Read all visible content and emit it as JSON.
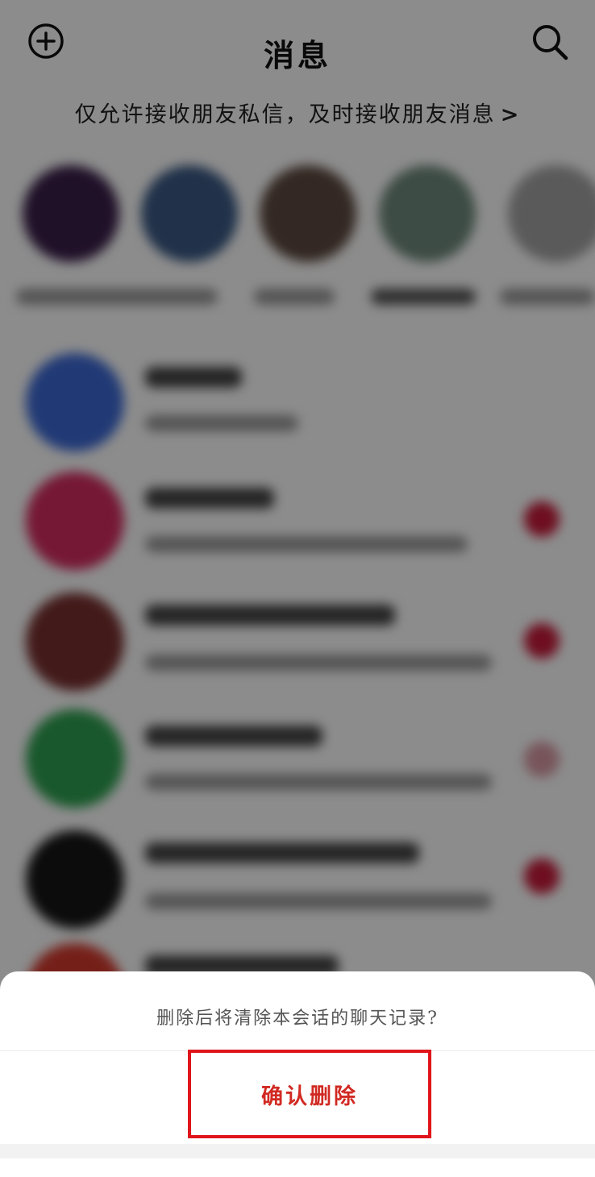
{
  "header": {
    "title": "消息",
    "add_icon": "plus-circle-icon",
    "search_icon": "search-icon"
  },
  "notice": {
    "text": "仅允许接收朋友私信，及时接收朋友消息",
    "arrow": ">"
  },
  "dialog": {
    "message": "删除后将清除本会话的聊天记录?",
    "confirm_label": "确认删除"
  },
  "colors": {
    "confirm_text": "#d12a22",
    "highlight_border": "#e0151b",
    "overlay": "rgba(0,0,0,0.45)"
  }
}
